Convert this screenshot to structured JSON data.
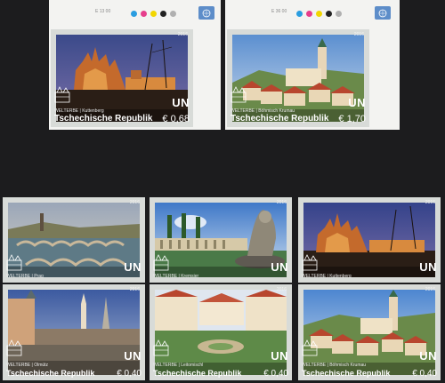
{
  "sheet": {
    "top_left": {
      "code": "E 13 00",
      "dots": [
        "#2a9de0",
        "#e63e8c",
        "#f2d600",
        "#222222",
        "#b0b0b0"
      ]
    },
    "top_right": {
      "code": "E 36 00",
      "dots": [
        "#2a9de0",
        "#e63e8c",
        "#f2d600",
        "#222222",
        "#b0b0b0"
      ]
    }
  },
  "colors": {
    "background": "#1c1c1e",
    "stamp_frame": "#d8dbd8",
    "un_blue": "#5d8dc9"
  },
  "stamps": [
    {
      "year": "2016",
      "logo": "UN",
      "caption": "WELTERBE | Kuttenberg",
      "country": "Tschechische Republik",
      "value": "€ 0,68",
      "scene": "kutna-hora-night"
    },
    {
      "year": "2016",
      "logo": "UN",
      "caption": "WELTERBE | Böhmisch Krumau",
      "country": "Tschechische Republik",
      "value": "€ 1,70",
      "scene": "cesky-krumlov"
    },
    {
      "year": "2016",
      "logo": "UN",
      "caption": "WELTERBE | Prag",
      "scene": "prague-bridges"
    },
    {
      "year": "2016",
      "logo": "UN",
      "caption": "WELTERBE | Kremsier",
      "scene": "kromeriz-fountain"
    },
    {
      "year": "2016",
      "logo": "UN",
      "caption": "WELTERBE | Kuttenberg",
      "scene": "kutna-hora-night"
    },
    {
      "year": "2016",
      "logo": "UN",
      "caption": "WELTERBE | Olmütz",
      "country": "Tschechische Republik",
      "value": "€ 0,40",
      "scene": "olomouc"
    },
    {
      "year": "2016",
      "logo": "UN",
      "caption": "WELTERBE | Leitomischl",
      "country": "Tschechische Republik",
      "value": "€ 0,40",
      "scene": "litomysl"
    },
    {
      "year": "2016",
      "logo": "UN",
      "caption": "WELTERBE | Böhmisch Krumau",
      "country": "Tschechische Republik",
      "value": "€ 0,40",
      "scene": "cesky-krumlov"
    }
  ]
}
